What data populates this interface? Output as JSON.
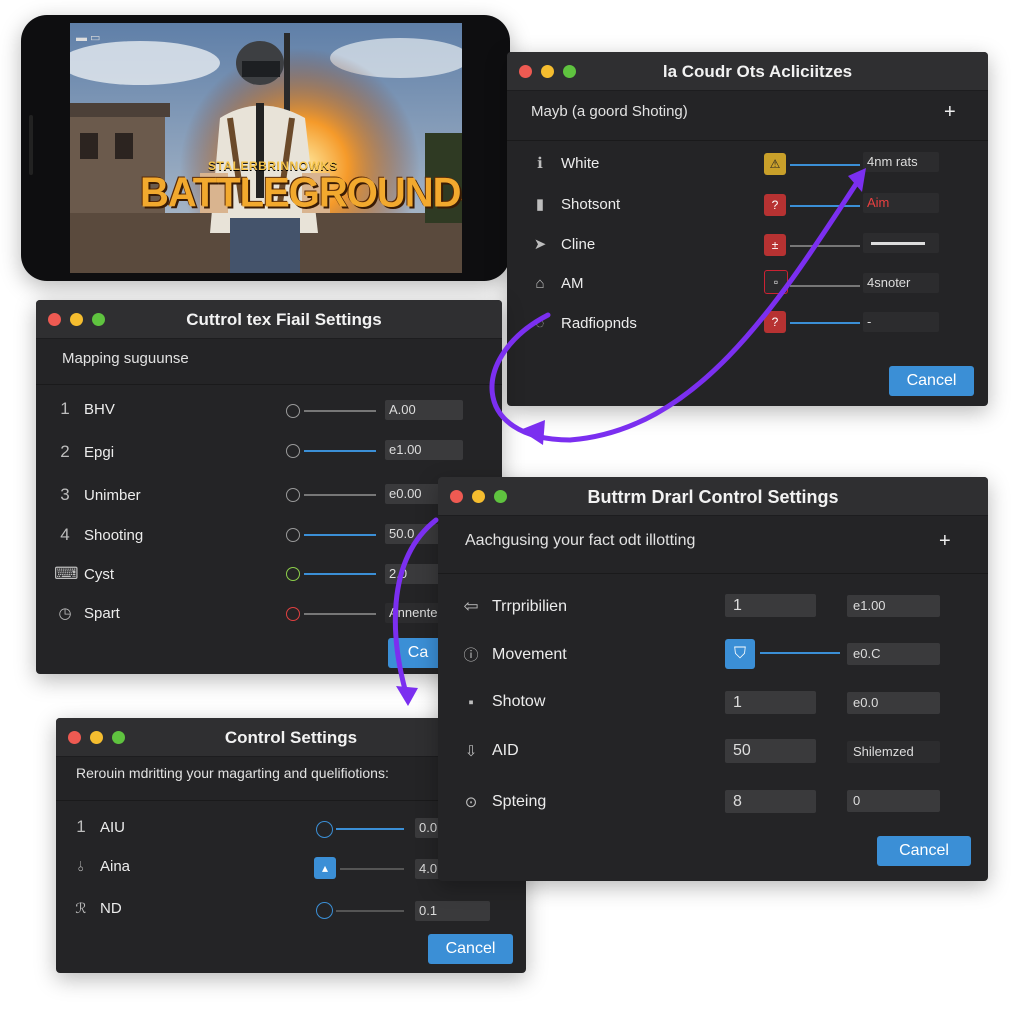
{
  "phone": {
    "logo_top": "STALERBRINNOWKS",
    "logo_main": "BATTLEGROUNDS"
  },
  "win1": {
    "title": "la Coudr Ots Acliciitzes",
    "subheading": "Mayb (a goord Shoting)",
    "plus": "+",
    "rows": [
      {
        "label": "White",
        "value": "4nm rats"
      },
      {
        "label": "Shotsont",
        "value": "Aim"
      },
      {
        "label": "Cline",
        "value": ""
      },
      {
        "label": "AM",
        "value": "4snoter"
      },
      {
        "label": "Radfiopnds",
        "value": "-"
      }
    ],
    "cancel": "Cancel"
  },
  "win2": {
    "title": "Cuttrol tex Fiail Settings",
    "subheading": "Mapping suguunse",
    "rows": [
      {
        "num": "1",
        "label": "BHV",
        "value": "A.00"
      },
      {
        "num": "2",
        "label": "Epgi",
        "value": "e1.00"
      },
      {
        "num": "3",
        "label": "Unimber",
        "value": "e0.00"
      },
      {
        "num": "4",
        "label": "Shooting",
        "value": "50.0"
      },
      {
        "num": "",
        "label": "Cyst",
        "value": "2.0"
      },
      {
        "num": "",
        "label": "Spart",
        "value": "Annente"
      }
    ],
    "cancel": "Ca"
  },
  "win3": {
    "title": "Buttrm Drarl Control Settings",
    "subheading": "Aachgusing your fact odt illotting",
    "plus": "+",
    "rows": [
      {
        "label": "Trrpribilien",
        "input": "1",
        "value": "e1.00"
      },
      {
        "label": "Movement",
        "input": "",
        "value": "e0.C"
      },
      {
        "label": "Shotow",
        "input": "1",
        "value": "e0.0"
      },
      {
        "label": "AID",
        "input": "50",
        "value": "Shilemzed"
      },
      {
        "label": "Spteing",
        "input": "8",
        "value": "0"
      }
    ],
    "cancel": "Cancel"
  },
  "win4": {
    "title": "Control Settings",
    "subheading": "Rerouin mdritting your magarting and quelifiotions:",
    "rows": [
      {
        "num": "1",
        "label": "AIU",
        "value": "0.0"
      },
      {
        "num": "",
        "label": "Aina",
        "value": "4.0"
      },
      {
        "num": "",
        "label": "ND",
        "value": "0.1"
      }
    ],
    "cancel": "Cancel"
  },
  "colors": {
    "accent": "#3b8fd6",
    "arrow": "#7b2ff0",
    "window_bg": "#242426"
  }
}
